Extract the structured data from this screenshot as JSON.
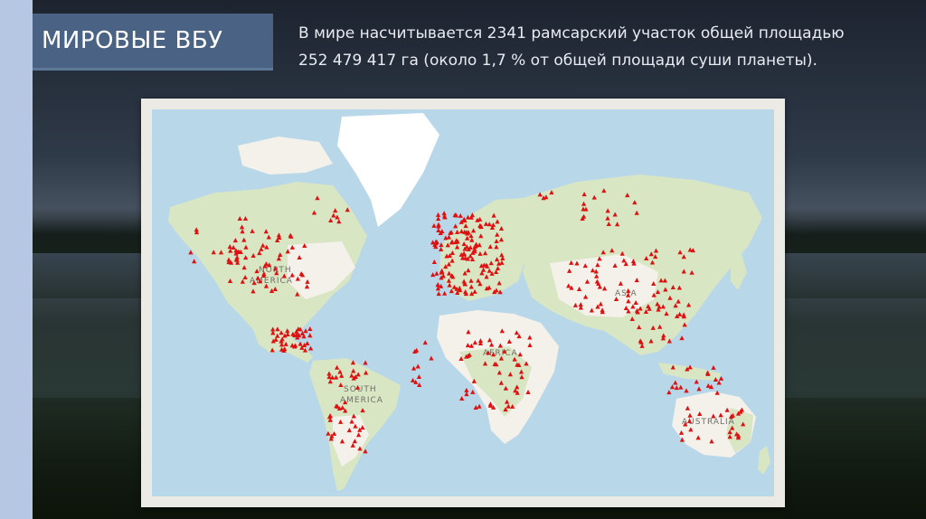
{
  "slide": {
    "title": "МИРОВЫЕ ВБУ",
    "description_line1": "В мире насчитывается 2341 рамсарский участок общей площадью",
    "description_line2": "252 479 417 га (около 1,7 % от общей площади суши планеты)."
  },
  "map": {
    "labels": {
      "north": "NORTH",
      "america": "AMERICA",
      "south": "SOUTH",
      "south_america": "AMERICA",
      "africa": "AFRICA",
      "asia": "ASIA",
      "australia": "AUSTRALIA"
    },
    "colors": {
      "ocean": "#b8d7e8",
      "land": "#f3f1ea",
      "vegetation": "#d8e6c4",
      "ice": "#ffffff",
      "marker": "#e01010",
      "frame": "#eceae5"
    },
    "marker_icon": "triangle-marker-icon"
  }
}
